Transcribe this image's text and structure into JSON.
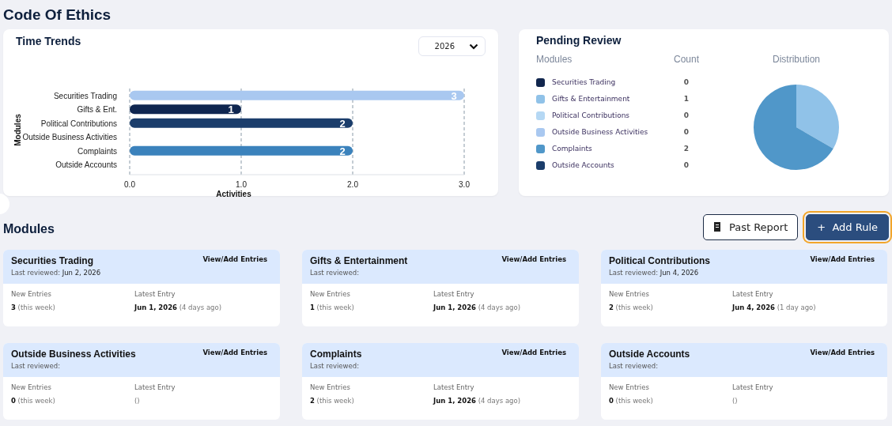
{
  "page_title": "Code Of Ethics",
  "time_trends": {
    "title": "Time Trends",
    "year_select": {
      "value": "2026"
    },
    "chart_data": {
      "type": "bar",
      "orientation": "horizontal",
      "xlabel": "Activities",
      "ylabel": "Modules",
      "categories": [
        "Securities Trading",
        "Gifts & Ent.",
        "Political Contributions",
        "Outside Business Activities",
        "Complaints",
        "Outside Accounts"
      ],
      "values": [
        3,
        1,
        2,
        0,
        2,
        0
      ],
      "colors": [
        "#a9c8f0",
        "#0f2650",
        "#1b3d6b",
        null,
        "#3b82bc",
        null
      ],
      "xlim": [
        0,
        3
      ],
      "xticks": [
        {
          "value": 0,
          "label": "0.0"
        },
        {
          "value": 1,
          "label": "1.0"
        },
        {
          "value": 2,
          "label": "2.0"
        },
        {
          "value": 3,
          "label": "3.0"
        }
      ],
      "value_labels": [
        "3",
        "1",
        "2",
        null,
        "2",
        null
      ]
    }
  },
  "pending_review": {
    "title": "Pending Review",
    "columns": [
      "Modules",
      "Count",
      "Distribution"
    ],
    "items": [
      {
        "name": "Securities Trading",
        "count": "0",
        "color": "#11264d"
      },
      {
        "name": "Gifts & Entertainment",
        "count": "1",
        "color": "#90c2e8"
      },
      {
        "name": "Political Contributions",
        "count": "0",
        "color": "#b5d8f4"
      },
      {
        "name": "Outside Business Activities",
        "count": "0",
        "color": "#a9c8f0"
      },
      {
        "name": "Complaints",
        "count": "2",
        "color": "#5097c9"
      },
      {
        "name": "Outside Accounts",
        "count": "0",
        "color": "#1b3d6b"
      }
    ]
  },
  "modules_section": {
    "title": "Modules",
    "buttons": [
      {
        "kind": "outline",
        "label": "Past Report",
        "focused": false
      },
      {
        "kind": "primary",
        "label": "+  Add Rule",
        "focused": true
      }
    ]
  },
  "modules": [
    {
      "name": "Securities Trading",
      "link": "View/Add Entries",
      "last_reviewed_label": "Last reviewed:",
      "last_reviewed": "Jun 2, 2026",
      "new_label": "New Entries",
      "new_count": "3",
      "new_note": "(this week)",
      "latest_label": "Latest Entry",
      "latest_date": "Jun 1, 2026",
      "latest_relative": "(4 days ago)"
    },
    {
      "name": "Gifts & Entertainment",
      "link": "View/Add Entries",
      "last_reviewed_label": "Last reviewed:",
      "new_label": "New Entries",
      "new_count": "1",
      "new_note": "(this week)",
      "latest_label": "Latest Entry",
      "latest_date": "Jun 1, 2026",
      "latest_relative": "(4 days ago)"
    },
    {
      "name": "Political Contributions",
      "link": "View/Add Entries",
      "last_reviewed_label": "Last reviewed:",
      "last_reviewed": "Jun 4, 2026",
      "new_label": "New Entries",
      "new_count": "2",
      "new_note": "(this week)",
      "latest_label": "Latest Entry",
      "latest_date": "Jun 4, 2026",
      "latest_relative": "(1 day ago)"
    },
    {
      "name": "Outside Business Activities",
      "link": "View/Add Entries",
      "last_reviewed_label": "Last reviewed:",
      "new_label": "New Entries",
      "new_count": "0",
      "new_note": "(this week)",
      "latest_label": "Latest Entry",
      "latest_relative": "()"
    },
    {
      "name": "Complaints",
      "link": "View/Add Entries",
      "last_reviewed_label": "Last reviewed:",
      "new_label": "New Entries",
      "new_count": "2",
      "new_note": "(this week)",
      "latest_label": "Latest Entry",
      "latest_date": "Jun 1, 2026",
      "latest_relative": "(4 days ago)"
    },
    {
      "name": "Outside Accounts",
      "link": "View/Add Entries",
      "last_reviewed_label": "Last reviewed:",
      "new_label": "New Entries",
      "new_count": "0",
      "new_note": "(this week)",
      "latest_label": "Latest Entry",
      "latest_relative": "()"
    }
  ]
}
